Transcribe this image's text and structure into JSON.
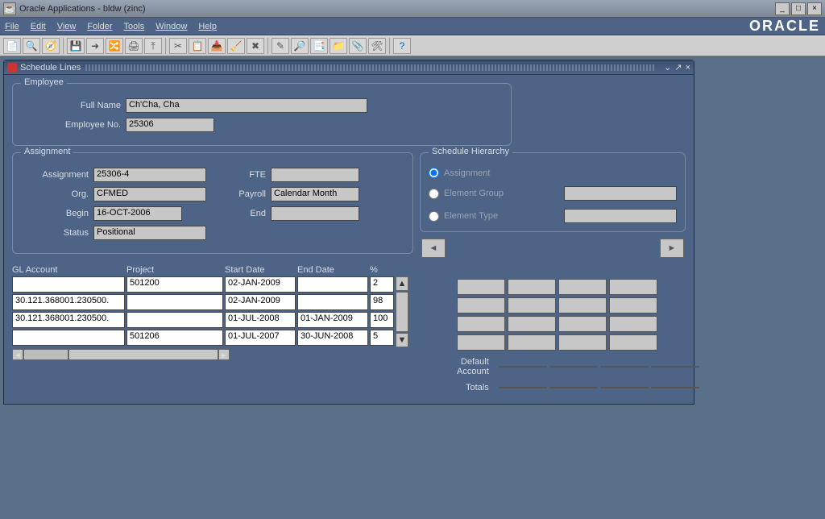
{
  "window": {
    "title": "Oracle Applications - bldw (zinc)"
  },
  "menu": {
    "items": [
      "File",
      "Edit",
      "View",
      "Folder",
      "Tools",
      "Window",
      "Help"
    ],
    "brand": "ORACLE"
  },
  "iframe": {
    "title": "Schedule Lines"
  },
  "employee": {
    "legend": "Employee",
    "full_name_label": "Full Name",
    "full_name": "Ch'Cha, Cha",
    "emp_no_label": "Employee No.",
    "emp_no": "25306"
  },
  "assignment": {
    "legend": "Assignment",
    "assignment_label": "Assignment",
    "assignment": "25306-4",
    "org_label": "Org.",
    "org": "CFMED",
    "begin_label": "Begin",
    "begin": "16-OCT-2006",
    "status_label": "Status",
    "status": "Positional",
    "fte_label": "FTE",
    "fte": "",
    "payroll_label": "Payroll",
    "payroll": "Calendar Month",
    "end_label": "End",
    "end": ""
  },
  "hierarchy": {
    "legend": "Schedule Hierarchy",
    "opt_assignment": "Assignment",
    "opt_element_group": "Element Group",
    "opt_element_type": "Element Type"
  },
  "table": {
    "headers": {
      "gl": "GL Account",
      "project": "Project",
      "start": "Start Date",
      "end": "End Date",
      "pct": "%"
    },
    "rows": [
      {
        "gl": "",
        "project": "501200",
        "start": "02-JAN-2009",
        "end": "",
        "pct": "2"
      },
      {
        "gl": "30.121.368001.230500.",
        "project": "",
        "start": "02-JAN-2009",
        "end": "",
        "pct": "98"
      },
      {
        "gl": "30.121.368001.230500.",
        "project": "",
        "start": "01-JUL-2008",
        "end": "01-JAN-2009",
        "pct": "100"
      },
      {
        "gl": "",
        "project": "501206",
        "start": "01-JUL-2007",
        "end": "30-JUN-2008",
        "pct": "5"
      }
    ]
  },
  "summary": {
    "default_account_label": "Default Account",
    "totals_label": "Totals"
  }
}
